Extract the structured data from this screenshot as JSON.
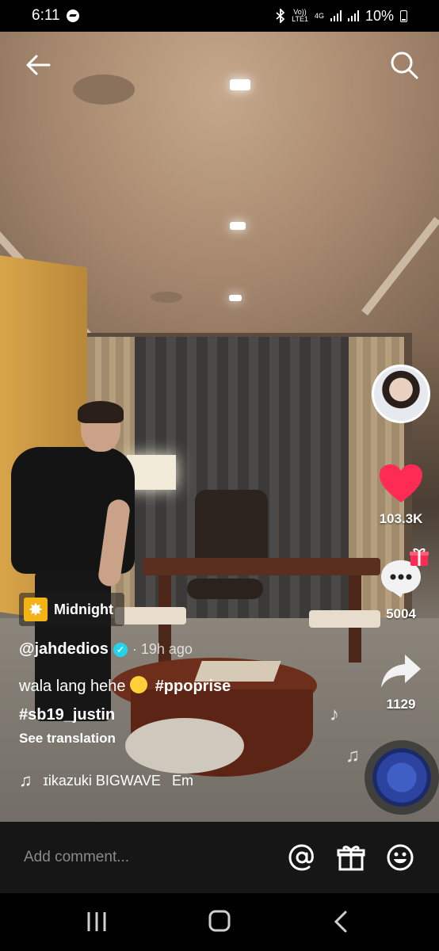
{
  "status_bar": {
    "time": "6:11",
    "network_top": "Vo))",
    "network_bottom": "LTE1",
    "network_type": "4G",
    "battery": "10%",
    "icons": [
      "messenger-icon",
      "bluetooth-icon",
      "signal-icon",
      "battery-icon"
    ]
  },
  "header": {
    "back_icon": "arrow-left-icon",
    "search_icon": "search-icon"
  },
  "side_actions": {
    "likes": "103.3K",
    "comments": "5004",
    "shares": "1129"
  },
  "effect": {
    "label": "Midnight"
  },
  "post": {
    "username": "@jahdedios",
    "time_ago": "· 19h ago",
    "caption_text": "wala lang hehe",
    "hashtag1": "#ppoprise",
    "hashtag2": "#sb19_justin",
    "see_translation": "See translation",
    "sound": "ɪikazuki BIGWAVE",
    "sound_2": "Em"
  },
  "comment_bar": {
    "placeholder": "Add comment..."
  },
  "colors": {
    "like": "#fe2c55",
    "verified": "#20d5ec",
    "effect_icon": "#f1b316",
    "comment_bar_bg": "#161616"
  }
}
